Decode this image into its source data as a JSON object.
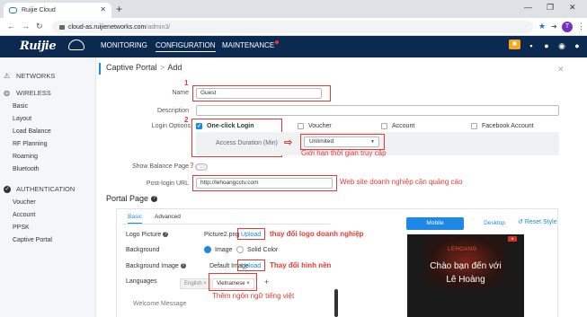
{
  "browser": {
    "tab_title": "Ruijie Cloud",
    "url_host": "cloud-as.ruijienetworks.com",
    "url_path": "/admin3/",
    "profile_letter": "T"
  },
  "header": {
    "logo_text": "Ruijie",
    "nav": [
      "MONITORING",
      "CONFIGURATION",
      "MAINTENANCE"
    ],
    "active_nav": "CONFIGURATION"
  },
  "sidebar": {
    "networks_label": "NETWORKS",
    "wireless_label": "WIRELESS",
    "wireless_items": [
      "Basic",
      "Layout",
      "Load Balance",
      "RF Planning",
      "Roaming",
      "Bluetooth"
    ],
    "auth_label": "AUTHENTICATION",
    "auth_items": [
      "Voucher",
      "Account",
      "PPSK",
      "Captive Portal"
    ]
  },
  "page": {
    "breadcrumb_parent": "Captive Portal",
    "breadcrumb_sep": ">",
    "breadcrumb_current": "Add"
  },
  "form": {
    "name_label": "Name",
    "name_value": "Guest",
    "description_label": "Description",
    "description_value": "",
    "login_options_label": "Login Options",
    "options": [
      {
        "label": "One-click Login",
        "checked": true
      },
      {
        "label": "Voucher",
        "checked": false
      },
      {
        "label": "Account",
        "checked": false
      },
      {
        "label": "Facebook Account",
        "checked": false
      }
    ],
    "duration_label": "Access Duration (Min)",
    "duration_value": "Unlimited",
    "show_balance_label": "Show Balance Page",
    "post_login_label": "Post-login URL",
    "post_login_value": "http://lehoangcctv.com"
  },
  "annotations": {
    "num1": "1",
    "num2": "2",
    "access_limit": "Giới hạn thời gian truy cập",
    "website_ad": "Web site doanh nghiệp cần quảng cáo",
    "change_logo": "thay đổi logo doanh nghiệp",
    "change_bg": "Thay đổi hình nền",
    "add_lang": "Thêm ngôn ngữ tiếng việt"
  },
  "portal": {
    "title": "Portal Page",
    "tabs": [
      "Basic",
      "Advanced"
    ],
    "logo_label": "Logo Picture",
    "logo_file": "Picture2.png",
    "upload_label": "Upload",
    "background_label": "Background",
    "bg_option_image": "Image",
    "bg_option_color": "Solid Color",
    "bg_image_label": "Background Image",
    "bg_image_value": "Default Image",
    "languages_label": "Languages",
    "lang_english": "English ×",
    "lang_vietnamese": "Vietnamese ×",
    "add_lang_plus": "+",
    "welcome_label": "Welcome Message"
  },
  "preview": {
    "mobile_label": "Mobile",
    "desktop_label": "Desktop",
    "reset_label": "Reset Style",
    "brand": "LEHOANG",
    "line1": "Chào bạn đến với",
    "line2": "Lê Hoàng"
  },
  "colors": {
    "header_bg": "#0c2a50",
    "accent": "#1e88e5",
    "annotation_red": "#e53935"
  }
}
